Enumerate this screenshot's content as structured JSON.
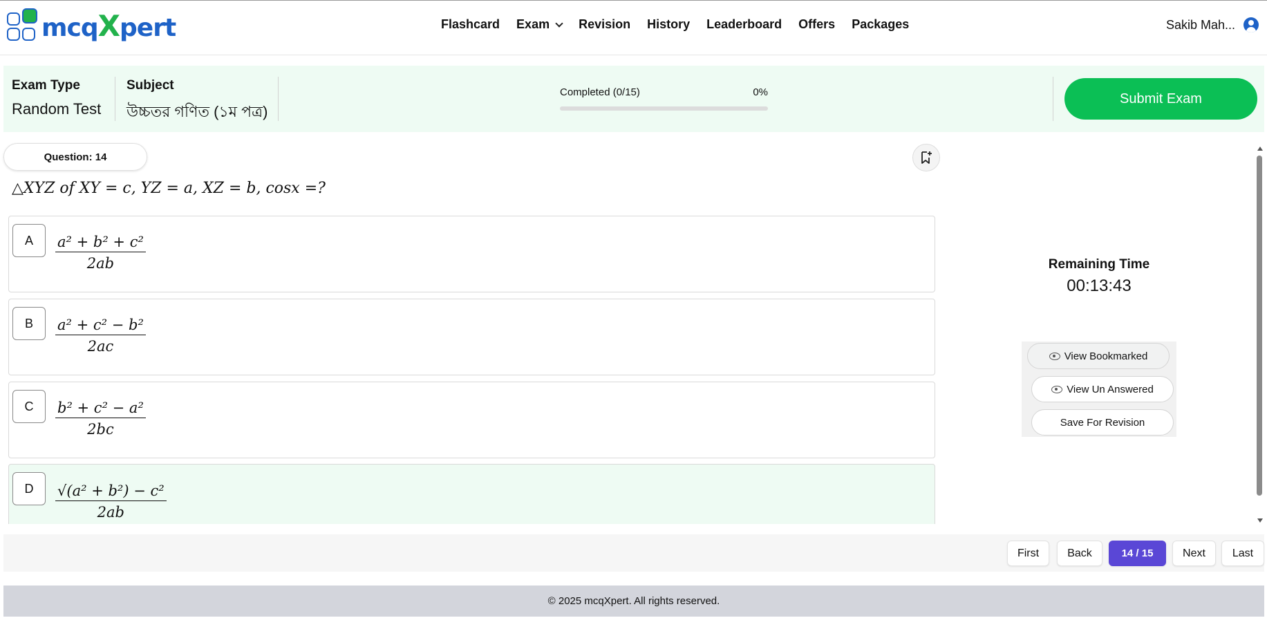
{
  "brand": {
    "name_prefix": "mcq",
    "name_x": "X",
    "name_suffix": "pert"
  },
  "nav": {
    "links": [
      "Flashcard",
      "Exam",
      "Revision",
      "History",
      "Leaderboard",
      "Offers",
      "Packages"
    ],
    "user_name": "Sakib Mah..."
  },
  "exam": {
    "type_label": "Exam Type",
    "type_value": "Random Test",
    "subject_label": "Subject",
    "subject_value": "উচ্চতর গণিত (১ম পত্র)",
    "progress_label": "Completed (0/15)",
    "progress_percent_text": "0%",
    "progress_fraction": 0,
    "submit_label": "Submit Exam"
  },
  "question": {
    "number_label": "Question: 14",
    "text": "△XYZ of XY = c, YZ = a, XZ = b, cosx =?",
    "options": [
      {
        "letter": "A",
        "numerator": "a² + b² + c²",
        "denominator": "2ab"
      },
      {
        "letter": "B",
        "numerator": "a² + c² − b²",
        "denominator": "2ac"
      },
      {
        "letter": "C",
        "numerator": "b² + c² − a²",
        "denominator": "2bc"
      },
      {
        "letter": "D",
        "numerator": "√(a² + b²) − c²",
        "denominator": "2ab"
      }
    ]
  },
  "timer": {
    "label": "Remaining Time",
    "value": "00:13:43"
  },
  "side": {
    "view_bookmarked": "View Bookmarked",
    "view_unanswered": "View Un Answered",
    "save_revision": "Save For Revision"
  },
  "pager": {
    "first": "First",
    "back": "Back",
    "current": "14 / 15",
    "next": "Next",
    "last": "Last"
  },
  "footer": {
    "text": "© 2025 mcqXpert. All rights reserved."
  },
  "colors": {
    "brand_blue": "#1e62c7",
    "brand_green": "#22b24c",
    "submit_green": "#0bbf55",
    "pager_active": "#5a47d6",
    "header_bg": "#eefbf3"
  }
}
